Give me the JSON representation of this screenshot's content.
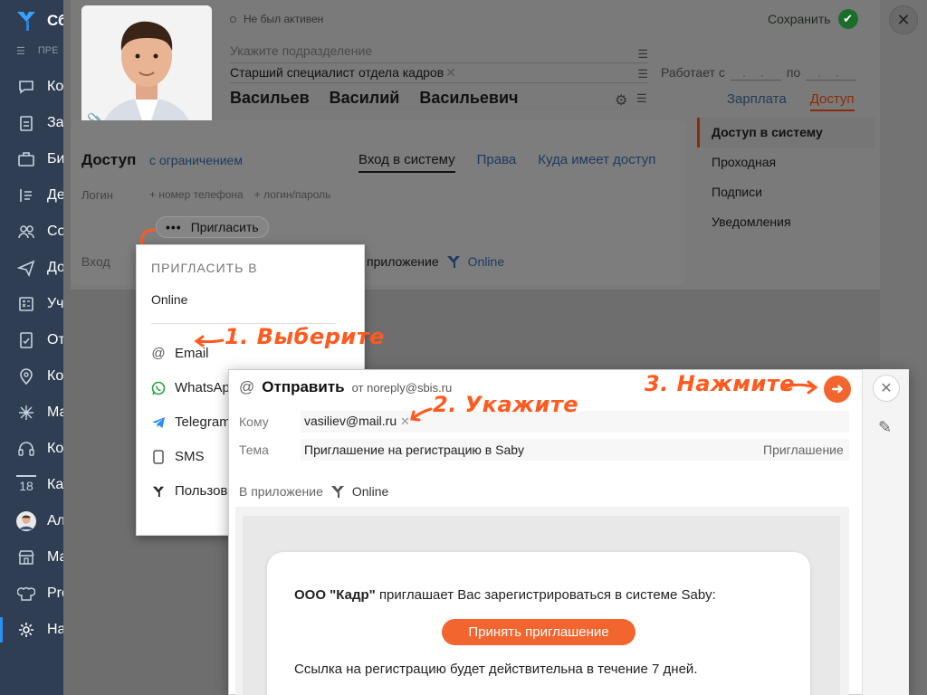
{
  "sidebar": {
    "title": "Сб",
    "subtitle": "ПРЕ",
    "items": [
      {
        "label": "Ко",
        "icon": "chat-icon"
      },
      {
        "label": "За",
        "icon": "tasks-icon"
      },
      {
        "label": "Би",
        "icon": "briefcase-icon"
      },
      {
        "label": "Де",
        "icon": "documents-icon"
      },
      {
        "label": "Со",
        "icon": "people-icon"
      },
      {
        "label": "До",
        "icon": "send-icon"
      },
      {
        "label": "Уч",
        "icon": "calculator-icon"
      },
      {
        "label": "От",
        "icon": "report-icon"
      },
      {
        "label": "Ко",
        "icon": "location-icon"
      },
      {
        "label": "Ма",
        "icon": "sparkle-icon"
      },
      {
        "label": "Ко",
        "icon": "headset-icon"
      },
      {
        "label": "Ка",
        "icon": "calendar-icon",
        "badge": "18"
      },
      {
        "label": "Ал",
        "icon": "avatar-icon"
      },
      {
        "label": "Ма",
        "icon": "store-icon"
      },
      {
        "label": "Pro",
        "icon": "chef-icon"
      },
      {
        "label": "На",
        "icon": "gear-icon"
      }
    ]
  },
  "profile": {
    "status": "Не был активен",
    "department_placeholder": "Укажите подразделение",
    "position": "Старший специалист отдела кадров",
    "last_name": "Васильев",
    "first_name": "Василий",
    "patronymic": "Васильевич",
    "save_label": "Сохранить",
    "works_from_label": "Работает с",
    "works_to_label": "по",
    "date_placeholder": ". .",
    "tabs": [
      "Зарплата",
      "Доступ"
    ]
  },
  "access": {
    "title": "Доступ",
    "restriction": "с ограничением",
    "tabs": [
      "Вход в систему",
      "Права",
      "Куда имеет доступ"
    ],
    "login_label": "Логин",
    "add_phone": "+ номер телефона",
    "add_login": "+ логин/пароль",
    "invite_label": "Пригласить",
    "entry_label": "Вход",
    "app_label": "приложение",
    "online_label": "Online"
  },
  "side_menu": [
    "Доступ в систему",
    "Проходная",
    "Подписи",
    "Уведомления"
  ],
  "dropdown": {
    "title": "ПРИГЛАСИТЬ В",
    "online": "Online",
    "items": [
      "Email",
      "WhatsApp",
      "Telegram",
      "SMS",
      "Пользов"
    ]
  },
  "annotations": {
    "step1": "1. Выберите",
    "step2": "2. Укажите",
    "step3": "3. Нажмите"
  },
  "dialog": {
    "title": "Отправить",
    "from": "от noreply@sbis.ru",
    "to_label": "Кому",
    "to_value": "vasiliev@mail.ru",
    "subject_label": "Тема",
    "subject_value": "Приглашение на регистрацию в Saby",
    "subject_tag": "Приглашение",
    "in_app_label": "В приложение",
    "online_label": "Online",
    "letter_company": "ООО \"Кадр\"",
    "letter_text": "приглашает Вас зарегистрироваться в системе Saby:",
    "accept_label": "Принять приглашение",
    "letter_note": "Ссылка на регистрацию будет действительна в течение 7 дней."
  },
  "colors": {
    "accent": "#f3652e",
    "sidebar": "#2f3e52",
    "save_green": "#1a6e2c",
    "link": "#1e3a60"
  }
}
